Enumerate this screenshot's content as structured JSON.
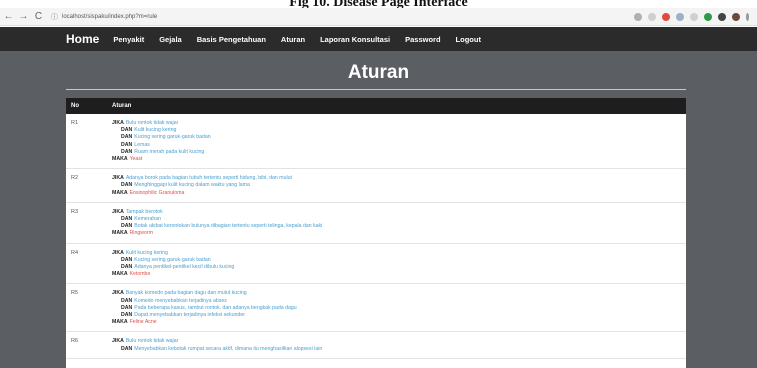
{
  "caption": "Fig 10. Disease Page Interface",
  "browser": {
    "url": "localhost/sispaku/index.php?m=rule",
    "back": "←",
    "forward": "→",
    "reload": "C",
    "info": "ⓘ"
  },
  "nav": {
    "home": "Home",
    "links": [
      "Penyakit",
      "Gejala",
      "Basis Pengetahuan",
      "Aturan",
      "Laporan Konsultasi",
      "Password",
      "Logout"
    ]
  },
  "page": {
    "title": "Aturan"
  },
  "table": {
    "headers": [
      "No",
      "Aturan"
    ],
    "rows": [
      {
        "no": "R1",
        "lines": [
          {
            "kw": "JIKA",
            "text": "Bulu rontok tidak wajar"
          },
          {
            "kw": "DAN",
            "text": "Kulit kucing kering"
          },
          {
            "kw": "DAN",
            "text": "Kucing sering garuk-garuk badan"
          },
          {
            "kw": "DAN",
            "text": "Lemas"
          },
          {
            "kw": "DAN",
            "text": "Ruam merah pada kulit kucing"
          }
        ],
        "result_kw": "MAKA",
        "result": "Yeast"
      },
      {
        "no": "R2",
        "lines": [
          {
            "kw": "JIKA",
            "text": "Adanya borok pada bagian tubuh tertentu seperti hidung, bibi, dan mulut"
          },
          {
            "kw": "DAN",
            "text": "Menghinggapi kulit kucing dalam waktu yang lama"
          }
        ],
        "result_kw": "MAKA",
        "result": "Eosinophilic Granuloma"
      },
      {
        "no": "R3",
        "lines": [
          {
            "kw": "JIKA",
            "text": "Tampak berotok"
          },
          {
            "kw": "DAN",
            "text": "Kemerahan"
          },
          {
            "kw": "DAN",
            "text": "Botak akibat kerontokan bulunya dibagian tertentu seperti telinga, kepala dan kaki"
          }
        ],
        "result_kw": "MAKA",
        "result": "Ringworm"
      },
      {
        "no": "R4",
        "lines": [
          {
            "kw": "JIKA",
            "text": "Kulit kucing kering"
          },
          {
            "kw": "DAN",
            "text": "Kucing sering garuk-garuk badan"
          },
          {
            "kw": "DAN",
            "text": "Adanya pentikel-pentikel kecil dibulu kucing"
          }
        ],
        "result_kw": "MAKA",
        "result": "Ketombe"
      },
      {
        "no": "R5",
        "lines": [
          {
            "kw": "JIKA",
            "text": "Banyak komedo pada bagian dagu dan mulut kucing"
          },
          {
            "kw": "DAN",
            "text": "Komedo menyebabkan terjadinya abses"
          },
          {
            "kw": "DAN",
            "text": "Pada beberapa kasus, rambut rontok, dan adanya bengkak pada dagu"
          },
          {
            "kw": "DAN",
            "text": "Dapat menyebabkan terjadinya infeksi sekunder"
          }
        ],
        "result_kw": "MAKA",
        "result": "Feline Acne"
      },
      {
        "no": "R6",
        "lines": [
          {
            "kw": "JIKA",
            "text": "Bulu rontok tidak wajar"
          },
          {
            "kw": "DAN",
            "text": "Menyebabkan kebotak rumpat secara aktif, dimana itu menghasilkan alopsesi lain"
          }
        ],
        "result_kw": "",
        "result": ""
      }
    ]
  },
  "colors": {
    "navbar_bg": "#2b2b2b",
    "band_bg": "#5b5e63",
    "symptom_text": "#4a9fd0",
    "result_text": "#d9534f"
  }
}
